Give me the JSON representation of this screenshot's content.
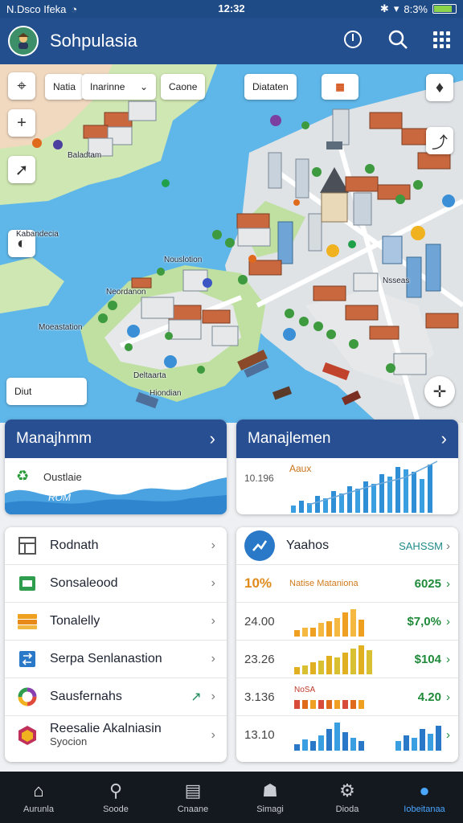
{
  "status": {
    "carrier": "N.Dsco Ifeka",
    "time": "12:32",
    "battery": "8:3%"
  },
  "app": {
    "title": "Sohpulasia"
  },
  "map": {
    "chips": {
      "chip1": "Natia",
      "chip2": "Inarinne",
      "chip3": "Caone",
      "chip4": "Diataten"
    },
    "labels": [
      "Kabandecia",
      "Nouslotion",
      "Neordanon",
      "Moeastation",
      "Deltaarta",
      "Hiondian",
      "Baladtam",
      "Nsseas"
    ],
    "bottom_chip": "Diut"
  },
  "card1": {
    "title": "Manajhmm",
    "label1": "Oustlaie",
    "label2": "ROM"
  },
  "card2": {
    "title": "Manajlemen",
    "label1": "Aaux",
    "tick": "10.196"
  },
  "list": {
    "items": [
      {
        "label": "Rodnath",
        "sub": ""
      },
      {
        "label": "Sonsaleood",
        "sub": ""
      },
      {
        "label": "Tonalelly",
        "sub": ""
      },
      {
        "label": "Serpa Senlanastion",
        "sub": ""
      },
      {
        "label": "Sausfernahs",
        "sub": ""
      },
      {
        "label": "Reesalie Akalniasin",
        "sub": "Syocion"
      }
    ]
  },
  "stats": {
    "title": "Yaahos",
    "link": "SAHSSM",
    "rows": [
      {
        "num": "10%",
        "note": "Natise Mataniona",
        "value": "6025"
      },
      {
        "num": "24.00",
        "note": "",
        "value": "$7,0%"
      },
      {
        "num": "23.26",
        "note": "",
        "value": "$104"
      },
      {
        "num": "3.136",
        "note": "NoSA",
        "value": "4.20"
      },
      {
        "num": "13.10",
        "note": "",
        "value": ""
      }
    ]
  },
  "nav": {
    "items": [
      "Aurunla",
      "Soode",
      "Cnaane",
      "Simagi",
      "Dioda",
      "Iobeitanaa"
    ]
  },
  "colors": {
    "primary": "#244f8f",
    "accent": "#2e8be0",
    "positive": "#1f8a3a",
    "water": "#5fb6e8",
    "land": "#cfe7b2"
  }
}
